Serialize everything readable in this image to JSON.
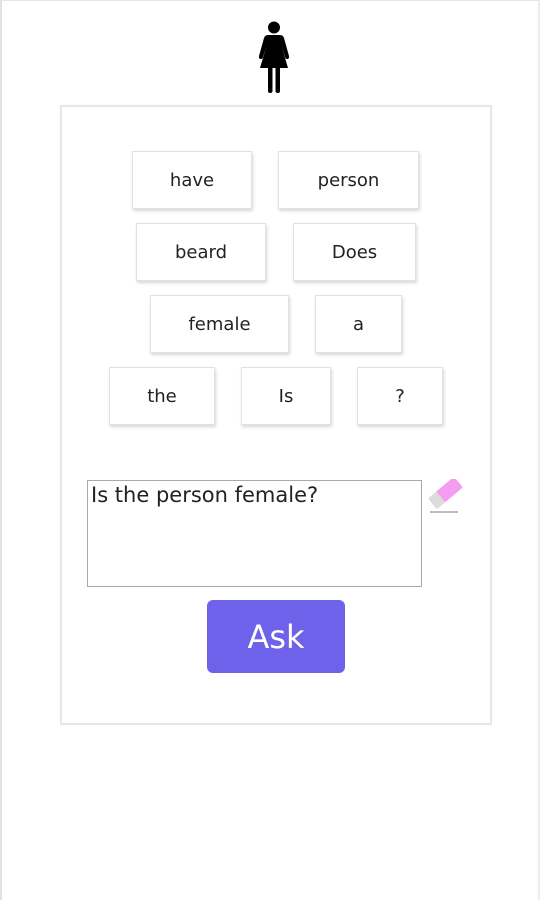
{
  "header": {
    "icon": "female-person-icon"
  },
  "word_chips": [
    {
      "label": "have"
    },
    {
      "label": "person"
    },
    {
      "label": "beard"
    },
    {
      "label": "Does"
    },
    {
      "label": "female"
    },
    {
      "label": "a"
    },
    {
      "label": "the"
    },
    {
      "label": "Is"
    },
    {
      "label": "?"
    }
  ],
  "question": {
    "value": "Is the person female?",
    "clear_icon": "eraser-icon"
  },
  "ask_button": {
    "label": "Ask"
  },
  "colors": {
    "accent": "#6f62ea",
    "eraser_pink": "#f49df0"
  }
}
